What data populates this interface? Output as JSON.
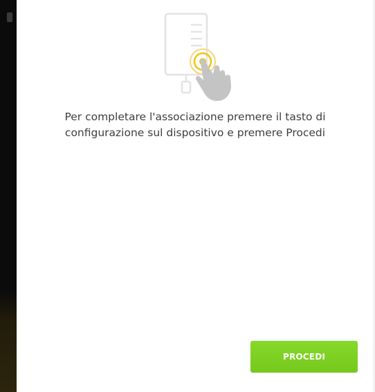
{
  "dialog": {
    "illustration_icon": "hand-pressing-device-button-icon",
    "message_line1": "Per completare l'associazione premere il tasto di",
    "message_line2": "configurazione sul dispositivo e premere Procedi",
    "proceed_label": "PROCEDI"
  },
  "colors": {
    "accent": "#7ed321",
    "highlight_ring": "#f1c40f",
    "text": "#3e3e3e",
    "backdrop": "#0b0b0b"
  }
}
